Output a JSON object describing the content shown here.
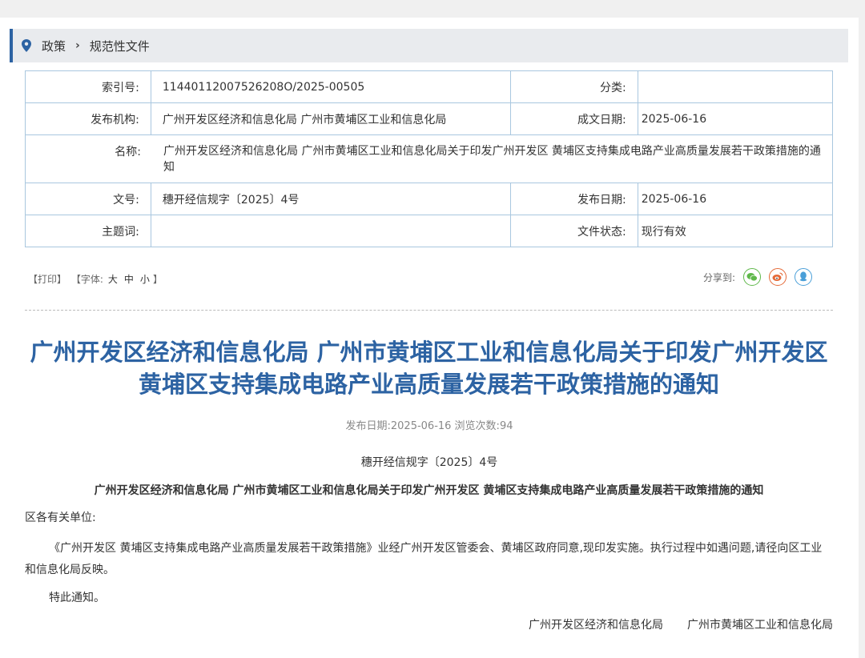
{
  "breadcrumb": {
    "items": [
      "政策",
      "规范性文件"
    ],
    "separator": "›"
  },
  "meta": {
    "index_label": "索引号:",
    "index_value": "11440112007526208O/2025-00505",
    "category_label": "分类:",
    "category_value": "",
    "publisher_label": "发布机构:",
    "publisher_value": "广州开发区经济和信息化局 广州市黄埔区工业和信息化局",
    "written_date_label": "成文日期:",
    "written_date_value": "2025-06-16",
    "name_label": "名称:",
    "name_value": "广州开发区经济和信息化局 广州市黄埔区工业和信息化局关于印发广州开发区 黄埔区支持集成电路产业高质量发展若干政策措施的通知",
    "doc_no_label": "文号:",
    "doc_no_value": "穗开经信规字〔2025〕4号",
    "pub_date_label": "发布日期:",
    "pub_date_value": "2025-06-16",
    "keywords_label": "主题词:",
    "keywords_value": "",
    "status_label": "文件状态:",
    "status_value": "现行有效"
  },
  "tools": {
    "print": "【打印】",
    "font_prefix": "【字体:",
    "font_large": "大",
    "font_medium": "中",
    "font_small": "小",
    "font_suffix": "】",
    "share_label": "分享到:"
  },
  "share_icons": [
    "wechat-icon",
    "weibo-icon",
    "qq-icon"
  ],
  "colors": {
    "accent": "#2d63a3",
    "table_border": "#a9c7df",
    "wechat": "#5fb84a",
    "weibo": "#e56a38",
    "qq": "#4a9fd8"
  },
  "article": {
    "title": "广州开发区经济和信息化局 广州市黄埔区工业和信息化局关于印发广州开发区 黄埔区支持集成电路产业高质量发展若干政策措施的通知",
    "pub_info": "发布日期:2025-06-16 浏览次数:94",
    "doc_no": "穗开经信规字〔2025〕4号",
    "subhead": "广州开发区经济和信息化局 广州市黄埔区工业和信息化局关于印发广州开发区 黄埔区支持集成电路产业高质量发展若干政策措施的通知",
    "addressee": "区各有关单位:",
    "paragraph": "《广州开发区 黄埔区支持集成电路产业高质量发展若干政策措施》业经广州开发区管委会、黄埔区政府同意,现印发实施。执行过程中如遇问题,请径向区工业和信息化局反映。",
    "notice": "特此通知。",
    "signature_1": "广州开发区经济和信息化局",
    "signature_2": "广州市黄埔区工业和信息化局"
  }
}
